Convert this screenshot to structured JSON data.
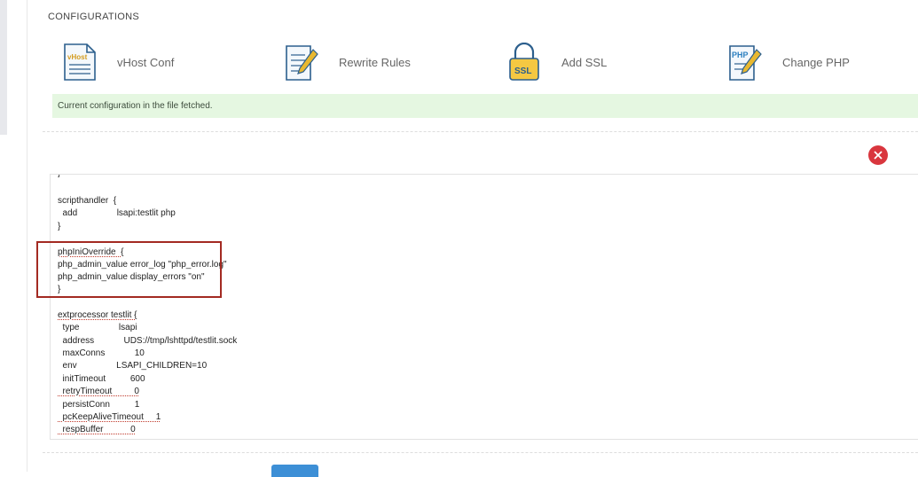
{
  "section_title": "CONFIGURATIONS",
  "configs": [
    {
      "label": "vHost Conf",
      "icon": "vhost-icon",
      "icon_text": "vHost"
    },
    {
      "label": "Rewrite Rules",
      "icon": "rewrite-icon",
      "icon_text": ""
    },
    {
      "label": "Add SSL",
      "icon": "ssl-lock-icon",
      "icon_text": "SSL"
    },
    {
      "label": "Change PHP",
      "icon": "php-icon",
      "icon_text": "PHP"
    }
  ],
  "alert_text": "Current configuration in the file fetched.",
  "code_lines": [
    "}",
    "",
    "scripthandler  {",
    "  add                lsapi:testlit php",
    "}",
    "",
    "phpIniOverride  {",
    "php_admin_value error_log \"php_error.log\"",
    "php_admin_value display_errors \"on\"",
    "}",
    "",
    "extprocessor testlit {",
    "  type                lsapi",
    "  address            UDS://tmp/lshttpd/testlit.sock",
    "  maxConns            10",
    "  env                LSAPI_CHILDREN=10",
    "  initTimeout          600",
    "  retryTimeout         0",
    "  persistConn          1",
    "  pcKeepAliveTimeout     1",
    "  respBuffer           0"
  ],
  "colors": {
    "alert_bg": "#e5f7e1",
    "close": "#d9363e",
    "highlight": "#a32a22",
    "button": "#3d8fd6"
  }
}
